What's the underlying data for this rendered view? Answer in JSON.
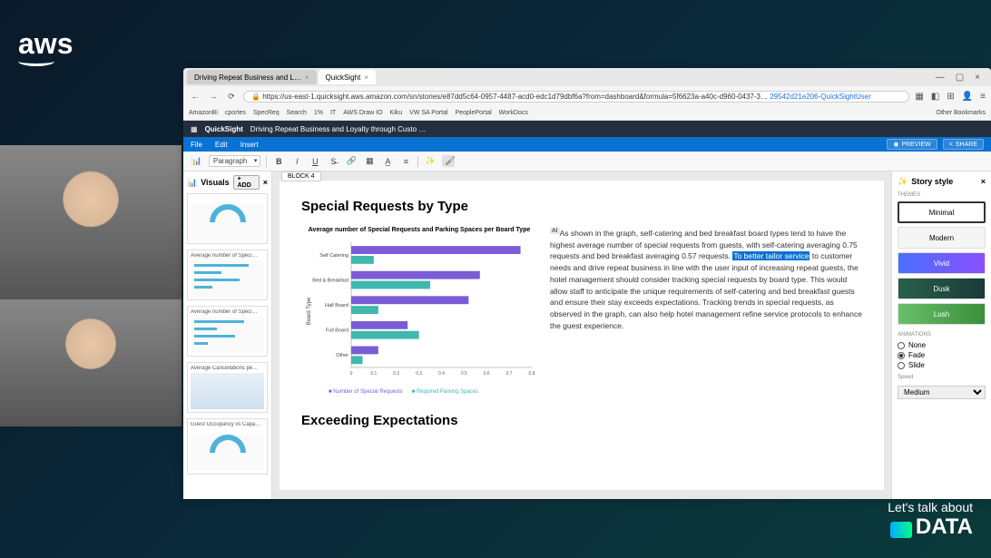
{
  "aws_logo": "aws",
  "tabs": [
    {
      "label": "Driving Repeat Business and L…",
      "active": false
    },
    {
      "label": "QuickSight",
      "active": true
    }
  ],
  "address": {
    "prefix": "https://us-east-1.quicksight.aws.amazon.com/sn/stories/e87dd5c64-0957-4487-acd0-edc1d79dbf6a?from=dashboard&formula=5f6623a-a40c-d960-0437-3…",
    "suffix": "29542d21e206-QuickSightUser"
  },
  "bookmarks": [
    "AmazonBi",
    "cportes",
    "SpecReq",
    "Search",
    "1%",
    "IT",
    "AWS Draw IO",
    "Kiku",
    "VW SA Portal",
    "PeoplePortal",
    "WorkDocs"
  ],
  "bm_other": "Other Bookmarks",
  "qs": {
    "brand": "QuickSight",
    "title": "Driving Repeat Business and Loyalty through Custo …",
    "menu": [
      "File",
      "Edit",
      "Insert"
    ],
    "preview": "PREVIEW",
    "share": "SHARE"
  },
  "toolbar": {
    "paragraph": "Paragraph",
    "block": "BLOCK 4"
  },
  "visuals": {
    "hdr": "Visuals",
    "add": "+ ADD",
    "thumbs": [
      "",
      "Average number of Speci…",
      "Average number of Speci…",
      "Average Cancellations pe…",
      "Guest Occupancy vs Capa…"
    ]
  },
  "doc": {
    "h1": "Special Requests by Type",
    "chart_title": "Average number of Special Requests and Parking Spaces per Board Type",
    "ylabel": "Board Type",
    "legend1": "Number of Special Requests",
    "legend2": "Required Parking Spaces",
    "ai": "AI",
    "para": "As shown in the graph, self-catering and bed breakfast board types tend to have the highest average number of special requests from guests, with self-catering averaging 0.75 requests and bed breakfast averaging 0.57 requests. ",
    "hl": "To better tailor service",
    "para2": " to customer needs and drive repeat business in line with the user input of increasing repeat guests, the hotel management should consider tracking special requests by board type. This would allow staff to anticipate the unique requirements of self-catering and bed breakfast guests and ensure their stay exceeds expectations. Tracking trends in special requests, as observed in the graph, can also help hotel management refine service protocols to enhance the guest experience.",
    "h2": "Exceeding Expectations"
  },
  "chart_data": {
    "type": "bar",
    "orientation": "horizontal",
    "categories": [
      "Self Catering",
      "Bed & Breakfast",
      "Half Board",
      "Full Board",
      "Other"
    ],
    "series": [
      {
        "name": "Number of Special Requests",
        "values": [
          0.75,
          0.57,
          0.52,
          0.25,
          0.12
        ],
        "color": "#7b5cd6"
      },
      {
        "name": "Required Parking Spaces",
        "values": [
          0.1,
          0.35,
          0.12,
          0.3,
          0.05
        ],
        "color": "#3fb8af"
      }
    ],
    "xlim": [
      0,
      0.8
    ],
    "xticks": [
      0,
      0.1,
      0.2,
      0.3,
      0.4,
      0.5,
      0.6,
      0.7,
      0.8
    ],
    "ylabel": "Board Type"
  },
  "story": {
    "hdr": "Story style",
    "sec1": "THEMES",
    "themes": [
      "Minimal",
      "Modern",
      "Vivid",
      "Dusk",
      "Lush"
    ],
    "sec2": "ANIMATIONS",
    "anims": [
      "None",
      "Fade",
      "Slide"
    ],
    "anim_selected": "Fade",
    "sec3": "Speed",
    "speed": "Medium"
  },
  "brand": {
    "t1": "Let's talk about",
    "t2": "DATA"
  }
}
